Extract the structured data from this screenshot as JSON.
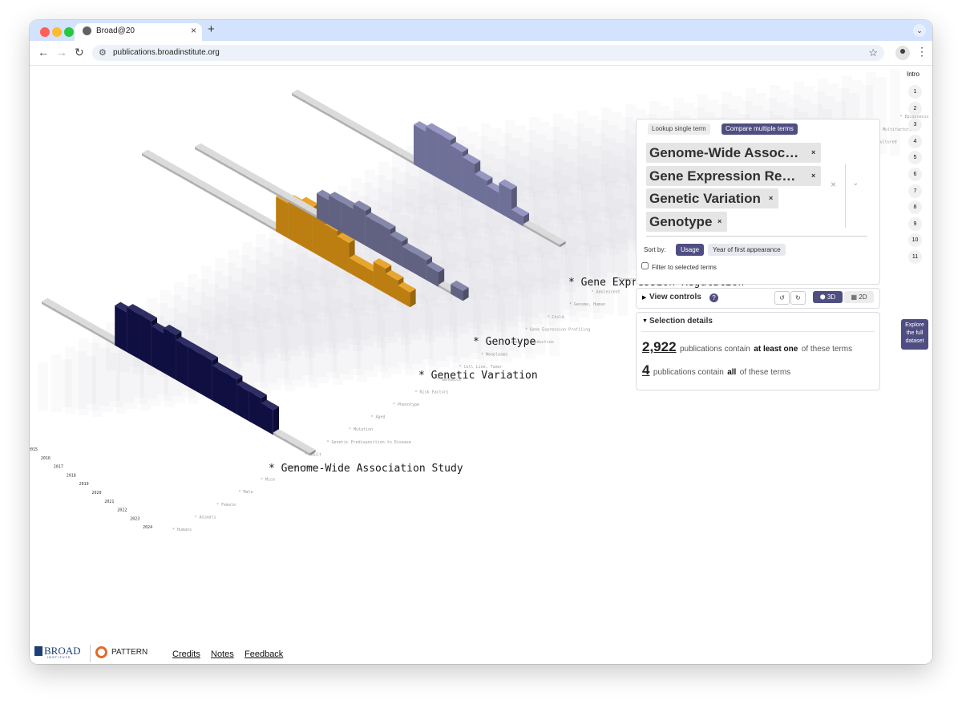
{
  "browser": {
    "tab_title": "Broad@20",
    "tab_close": "×",
    "new_tab": "+",
    "url": "publications.broadinstitute.org"
  },
  "viz": {
    "series": [
      {
        "label": "* Gene Expression Regulation",
        "color": "#8788b8",
        "values": [
          0,
          0,
          0,
          0,
          0,
          0,
          0,
          0,
          0,
          0,
          8,
          9,
          9,
          8,
          7,
          5,
          4,
          6,
          2,
          0,
          0,
          0
        ]
      },
      {
        "label": "* Genotype",
        "color": "#e59a13",
        "values": [
          0,
          0,
          0,
          0,
          0,
          0,
          0,
          0,
          0,
          0,
          0,
          7,
          8,
          9,
          8,
          7,
          6,
          3,
          3,
          5,
          4,
          3
        ]
      },
      {
        "label": "* Genetic Variation",
        "color": "#76789f",
        "values": [
          0,
          0,
          0,
          0,
          0,
          0,
          0,
          0,
          0,
          0,
          5,
          6,
          6,
          7,
          6,
          6,
          5,
          4,
          4,
          3,
          0,
          2
        ]
      },
      {
        "label": "* Genome-Wide Association Study",
        "color": "#13124f",
        "values": [
          0,
          0,
          0,
          0,
          0,
          0,
          8,
          9,
          9,
          8,
          9,
          8,
          8,
          8,
          7,
          7,
          6,
          6,
          5,
          0,
          0,
          0
        ]
      }
    ],
    "years": [
      "2015",
      "2016",
      "2017",
      "2018",
      "2019",
      "2020",
      "2021",
      "2022",
      "2023",
      "2024"
    ],
    "background_terms": [
      "Humans",
      "Animals",
      "Female",
      "Male",
      "Mice",
      "Middle Aged",
      "Adult",
      "Genetic Predisposition to Disease",
      "Mutation",
      "Aged",
      "Phenotype",
      "Risk Factors",
      "Genomics",
      "Cell Line, Tumor",
      "Neoplasms",
      "Signal Transduction",
      "Gene Expression Profiling",
      "Child",
      "Genome, Human",
      "Adolescent",
      "Transcriptome",
      "Cohort Studies",
      "Mice, Inbred C57BL",
      "Case-Control Studies",
      "Young Adult",
      "Alleles",
      "Transcription",
      "Brain",
      "Proteomics",
      "Cell Line",
      "HEK293 Cells",
      "Cells, Cultured",
      "Multifactorial",
      "Epigenesis"
    ]
  },
  "panel": {
    "tab_single": "Lookup single term",
    "tab_compare": "Compare multiple terms",
    "chips": [
      "Genome-Wide Assoc…",
      "Gene Expression Re…",
      "Genetic Variation",
      "Genotype"
    ],
    "chip_remove": "×",
    "clear_all": "×",
    "sort_label": "Sort by:",
    "sort_usage": "Usage",
    "sort_year": "Year of first appearance",
    "filter_label": "Filter to selected terms"
  },
  "view_controls": {
    "label": "View controls",
    "help": "?",
    "rotate_left": "↺",
    "rotate_right": "↻",
    "mode_3d": "3D",
    "mode_2d": "2D"
  },
  "selection": {
    "title": "Selection details",
    "count_any": "2,922",
    "text_any_1": "publications contain",
    "text_any_2": "at least one",
    "text_any_3": "of these terms",
    "count_all": "4",
    "text_all_1": "publications contain",
    "text_all_2": "all",
    "text_all_3": "of these terms"
  },
  "nav": {
    "intro": "Intro",
    "steps": [
      "1",
      "2",
      "3",
      "4",
      "5",
      "6",
      "7",
      "8",
      "9",
      "10",
      "11"
    ],
    "explore": "Explore the full dataset"
  },
  "footer": {
    "broad": "BROAD",
    "institute": "INSTITUTE",
    "pattern": "PATTERN",
    "links": [
      "Credits",
      "Notes",
      "Feedback"
    ]
  },
  "colors": {
    "accent": "#4f4e82",
    "gwas": "#13124f",
    "genotype": "#e59a13",
    "genetic_variation": "#76789f",
    "gene_expression": "#8788b8",
    "tab_bar": "#d3e3fd"
  }
}
